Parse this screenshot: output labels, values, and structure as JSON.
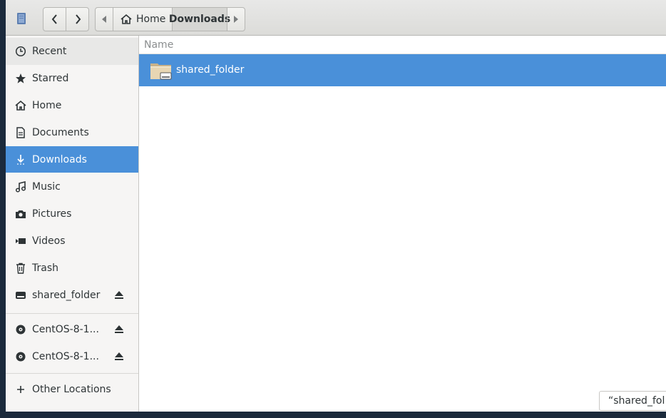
{
  "header": {
    "path": [
      {
        "label": "Home",
        "icon": "home-icon"
      },
      {
        "label": "Downloads"
      }
    ]
  },
  "sidebar": {
    "items": [
      {
        "label": "Recent",
        "icon": "clock-icon"
      },
      {
        "label": "Starred",
        "icon": "star-icon"
      },
      {
        "label": "Home",
        "icon": "home-icon"
      },
      {
        "label": "Documents",
        "icon": "document-icon"
      },
      {
        "label": "Downloads",
        "icon": "download-icon",
        "selected": true
      },
      {
        "label": "Music",
        "icon": "music-icon"
      },
      {
        "label": "Pictures",
        "icon": "camera-icon"
      },
      {
        "label": "Videos",
        "icon": "video-icon"
      },
      {
        "label": "Trash",
        "icon": "trash-icon"
      },
      {
        "label": "shared_folder",
        "icon": "drive-icon",
        "eject": true
      }
    ],
    "devices": [
      {
        "label": "CentOS-8-1...",
        "icon": "disc-icon",
        "eject": true
      },
      {
        "label": "CentOS-8-1...",
        "icon": "disc-icon",
        "eject": true
      }
    ],
    "other": {
      "label": "Other Locations",
      "icon": "plus-icon"
    }
  },
  "main": {
    "column_header": "Name",
    "files": [
      {
        "name": "shared_folder",
        "icon": "folder-icon",
        "selected": true
      }
    ]
  },
  "status": {
    "text": "“shared_fol"
  },
  "colors": {
    "accent": "#4a90d9",
    "sidebar_bg": "#f6f5f4",
    "desktop": "#1b2a3c"
  }
}
